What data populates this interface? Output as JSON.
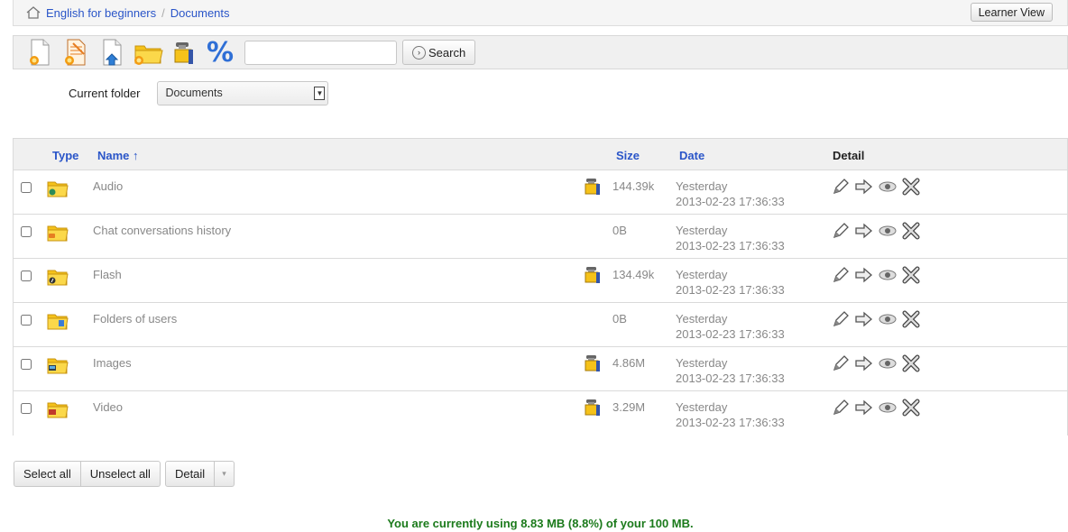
{
  "breadcrumb": {
    "course": "English for beginners",
    "separator": "/",
    "current": "Documents"
  },
  "header": {
    "learner_view_label": "Learner View"
  },
  "toolbar": {
    "tools": [
      "new-document-icon",
      "new-drawing-icon",
      "upload-icon",
      "new-folder-icon",
      "shared-folder-icon",
      "quota-icon"
    ],
    "quota_symbol": "%",
    "search_value": "",
    "search_label": "Search"
  },
  "folder": {
    "label": "Current folder",
    "selected": "Documents"
  },
  "table": {
    "headers": {
      "type": "Type",
      "name": "Name ↑",
      "size": "Size",
      "date": "Date",
      "detail": "Detail"
    },
    "rows": [
      {
        "icon": "folder-audio-icon",
        "name": "Audio",
        "shared": true,
        "size": "144.39k",
        "date1": "Yesterday",
        "date2": "2013-02-23 17:36:33"
      },
      {
        "icon": "folder-chat-icon",
        "name": "Chat conversations history",
        "shared": false,
        "size": "0B",
        "date1": "Yesterday",
        "date2": "2013-02-23 17:36:33"
      },
      {
        "icon": "folder-flash-icon",
        "name": "Flash",
        "shared": true,
        "size": "134.49k",
        "date1": "Yesterday",
        "date2": "2013-02-23 17:36:33"
      },
      {
        "icon": "folder-users-icon",
        "name": "Folders of users",
        "shared": false,
        "size": "0B",
        "date1": "Yesterday",
        "date2": "2013-02-23 17:36:33"
      },
      {
        "icon": "folder-images-icon",
        "name": "Images",
        "shared": true,
        "size": "4.86M",
        "date1": "Yesterday",
        "date2": "2013-02-23 17:36:33"
      },
      {
        "icon": "folder-video-icon",
        "name": "Video",
        "shared": true,
        "size": "3.29M",
        "date1": "Yesterday",
        "date2": "2013-02-23 17:36:33"
      }
    ]
  },
  "bulk": {
    "select_all": "Select all",
    "unselect_all": "Unselect all",
    "detail": "Detail",
    "caret": "▾"
  },
  "quota": {
    "text": "You are currently using 8.83 MB (8.8%) of your 100 MB."
  },
  "colors": {
    "link": "#2a55c8",
    "quota": "#1b7a1b",
    "folder": "#f5c21a"
  }
}
